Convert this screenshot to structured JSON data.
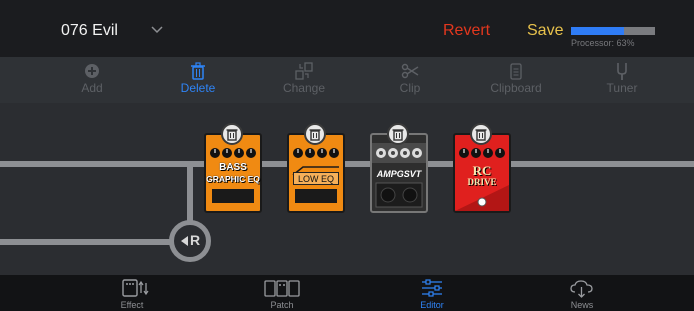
{
  "header": {
    "patch_name": "076 Evil",
    "revert_label": "Revert",
    "save_label": "Save",
    "processor_label": "Processor: 63%",
    "processor_value": 0.63,
    "accent_blue": "#2f7cf6",
    "revert_color": "#e2371e",
    "save_color": "#e8c24c"
  },
  "toolbar": {
    "items": [
      {
        "label": "Add",
        "icon": "plus-circle-icon"
      },
      {
        "label": "Delete",
        "icon": "trash-icon",
        "active": true
      },
      {
        "label": "Change",
        "icon": "swap-icon"
      },
      {
        "label": "Clip",
        "icon": "scissors-icon"
      },
      {
        "label": "Clipboard",
        "icon": "clipboard-icon"
      },
      {
        "label": "Tuner",
        "icon": "tuning-fork-icon"
      }
    ]
  },
  "pedals": [
    {
      "name_line1": "BASS",
      "name_line2": "GRAPHIC EQ",
      "color": "#f08a12"
    },
    {
      "name_line1": "LOW EQ",
      "color": "#f08a12"
    },
    {
      "name_line1": "AMPGSVT",
      "color": "#2e2e2e"
    },
    {
      "name_line1": "RC",
      "name_line2": "DRIVE",
      "color": "#e0201e"
    }
  ],
  "return_node": {
    "label": "R"
  },
  "bottom_tabs": [
    {
      "label": "Effect",
      "icon": "effect-icon"
    },
    {
      "label": "Patch",
      "icon": "patch-icon"
    },
    {
      "label": "Editor",
      "icon": "sliders-icon",
      "active": true
    },
    {
      "label": "News",
      "icon": "cloud-download-icon"
    }
  ]
}
